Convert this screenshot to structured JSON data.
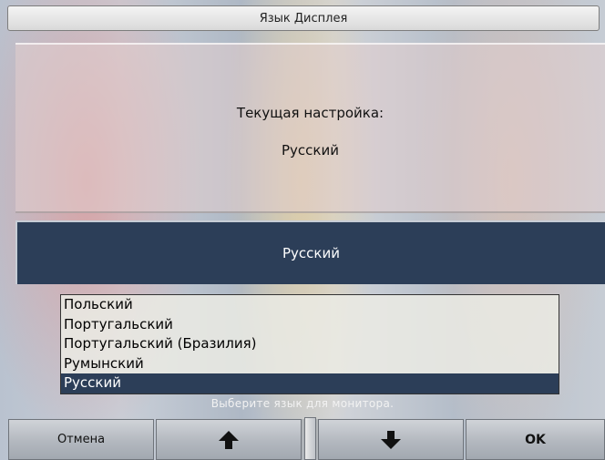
{
  "window": {
    "title": "Язык Дисплея"
  },
  "current_setting": {
    "label": "Текущая настройка:",
    "value": "Русский"
  },
  "selection": {
    "value": "Русский"
  },
  "language_list": {
    "items": [
      {
        "label": "Польский",
        "selected": false
      },
      {
        "label": "Португальский",
        "selected": false
      },
      {
        "label": "Португальский (Бразилия)",
        "selected": false
      },
      {
        "label": "Румынский",
        "selected": false
      },
      {
        "label": "Русский",
        "selected": true
      }
    ]
  },
  "hint": "Выберите язык для монитора.",
  "toolbar": {
    "cancel_label": "Отмена",
    "up_icon": "arrow-up-icon",
    "down_icon": "arrow-down-icon",
    "ok_label": "OK"
  },
  "colors": {
    "selected_bg": "#2c3e58",
    "selected_text": "#ffffff"
  }
}
